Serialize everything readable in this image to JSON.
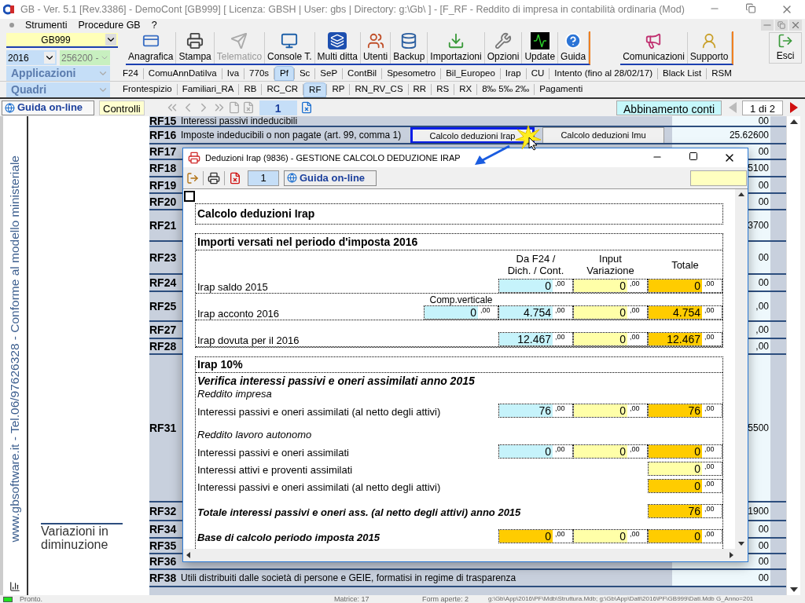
{
  "window": {
    "title": "GB - Ver. 5.1 [Rev.3386] -  DemoCont [GB999]      [ Licenza: GBSH | User: gbs | Directory: g:\\Gb\\ ] - [F_RF - Reddito di impresa in contabilità ordinaria (Mod)"
  },
  "menu": [
    "Strumenti",
    "Procedure GB",
    "?"
  ],
  "selectors": {
    "company": "GB999",
    "year": "2016",
    "code": "256200 -",
    "code_disabled": true,
    "app_menu": "Applicazioni",
    "form_menu": "Quadri"
  },
  "toolbar": {
    "main": [
      {
        "label": "Anagrafica",
        "disabled": false
      },
      {
        "label": "Stampa",
        "disabled": false
      },
      {
        "label": "Telematico",
        "disabled": true
      },
      {
        "label": "Console T.",
        "disabled": false
      },
      {
        "label": "Multi ditta",
        "disabled": false
      },
      {
        "label": "Utenti",
        "disabled": false
      },
      {
        "label": "Backup",
        "disabled": false
      },
      {
        "label": "Importazioni",
        "disabled": false
      },
      {
        "label": "Opzioni",
        "disabled": false
      },
      {
        "label": "Update",
        "disabled": false
      },
      {
        "label": "Guida",
        "disabled": false
      }
    ],
    "support": [
      {
        "label": "Comunicazioni",
        "disabled": false
      },
      {
        "label": "Supporto",
        "disabled": false
      }
    ],
    "exit": "Esci"
  },
  "app_tabs": [
    {
      "label": "F24",
      "selected": false
    },
    {
      "label": "ComuAnnDatiIva",
      "selected": false
    },
    {
      "label": "Iva",
      "selected": false
    },
    {
      "label": "770s",
      "selected": false
    },
    {
      "label": "Pf",
      "selected": true
    },
    {
      "label": "Sc",
      "selected": false
    },
    {
      "label": "SeP",
      "selected": false
    },
    {
      "label": "ContBil",
      "selected": false
    },
    {
      "label": "Spesometro",
      "selected": false
    },
    {
      "label": "Bil_Europeo",
      "selected": false
    },
    {
      "label": "Irap",
      "selected": false
    },
    {
      "label": "CU",
      "selected": false
    },
    {
      "label": "Intento (fino al 28/02/17)",
      "selected": false
    },
    {
      "label": "Black List",
      "selected": false
    },
    {
      "label": "RSM",
      "selected": false
    }
  ],
  "form_tabs": [
    {
      "label": "Frontespizio",
      "selected": false
    },
    {
      "label": "Familiari_RA",
      "selected": false
    },
    {
      "label": "RB",
      "selected": false
    },
    {
      "label": "RC_CR",
      "selected": false
    },
    {
      "label": "RF",
      "selected": true
    },
    {
      "label": "RP",
      "selected": false
    },
    {
      "label": "RN_RV_CS",
      "selected": false
    },
    {
      "label": "RR",
      "selected": false
    },
    {
      "label": "RS",
      "selected": false
    },
    {
      "label": "RX",
      "selected": false
    },
    {
      "label": "8‰ 5‰ 2‰",
      "selected": false
    },
    {
      "label": "Pagamenti",
      "selected": false
    }
  ],
  "nav": {
    "help": "Guida on-line",
    "checks": "Controlli",
    "page": "1",
    "link": "Abbinamento conti",
    "pages": "1 di 2"
  },
  "sidebar": {
    "vertical_text": "www.gbsoftware.it - Tel.06/97626328 - Conforme al modello ministeriale",
    "section": "Variazioni in diminuzione"
  },
  "rows": [
    {
      "code": "RF15",
      "description": "Interessi passivi indeducibili",
      "value": "00"
    },
    {
      "code": "RF16",
      "description": "Imposte indeducibili o non pagate (art. 99, comma 1)",
      "value": "25.62600"
    },
    {
      "code": "RF17",
      "value": "00"
    },
    {
      "code": "RF18",
      "value": "5100"
    },
    {
      "code": "RF19",
      "value": "00"
    },
    {
      "code": "RF20",
      "value": "00"
    },
    {
      "code": "RF21",
      "value": "3700"
    },
    {
      "code": "RF23",
      "value": "00"
    },
    {
      "code": "RF24",
      "value": "00"
    },
    {
      "code": "RF25",
      "value": ",00"
    },
    {
      "code": "RF27",
      "value": ",00"
    },
    {
      "code": "RF28",
      "value": ",00"
    },
    {
      "code": "RF31",
      "value": "5500"
    },
    {
      "code": "RF32",
      "value": "1900"
    },
    {
      "code": "RF34",
      "value": "00"
    },
    {
      "code": "RF35",
      "value": "00"
    },
    {
      "code": "RF36",
      "value": "00"
    },
    {
      "code": "RF38",
      "description": "Utili distribuiti dalle società di persone e GEIE, formatisi in regime di trasparenza",
      "value": "00"
    }
  ],
  "buttons": [
    {
      "label": "Calcolo deduzioni Irap",
      "highlighted": true
    },
    {
      "label": "Calcolo deduzioni Imu",
      "highlighted": false
    }
  ],
  "dialog": {
    "title": "Deduzioni Irap (9836) - GESTIONE CALCOLO DEDUZIONE IRAP",
    "page": "1",
    "help": "Guida on-line",
    "heading": "Calcolo deduzioni Irap",
    "section": {
      "title": "Importi versati nel periodo d'imposta 2016",
      "columns": [
        "Da F24 /\nDich. / Cont.",
        "Input\nVariazione",
        "Totale"
      ],
      "rows": [
        {
          "label": "Irap saldo 2015",
          "cells": {
            "f24": {
              "kind": "imported",
              "value": "0",
              "decimals": ",00"
            },
            "input": {
              "kind": "input",
              "value": "0",
              "decimals": ",00"
            },
            "total": {
              "kind": "computed",
              "value": "0",
              "decimals": ",00"
            }
          }
        },
        {
          "label": "Irap acconto 2016",
          "extra": {
            "label": "Comp.verticale",
            "cell": {
              "kind": "imported",
              "value": "0",
              "decimals": ",00"
            }
          },
          "cells": {
            "f24": {
              "kind": "imported",
              "value": "4.754",
              "decimals": ",00"
            },
            "input": {
              "kind": "input",
              "value": "0",
              "decimals": ",00"
            },
            "total": {
              "kind": "computed",
              "value": "4.754",
              "decimals": ",00"
            }
          }
        },
        {
          "label": "Irap dovuta per il 2016",
          "cells": {
            "f24": {
              "kind": "imported",
              "value": "12.467",
              "decimals": ",00"
            },
            "input": {
              "kind": "input",
              "value": "0",
              "decimals": ",00"
            },
            "total": {
              "kind": "computed",
              "value": "12.467",
              "decimals": ",00"
            }
          }
        }
      ]
    },
    "section2": {
      "title": "Irap 10%",
      "items": [
        {
          "kind": "subtitle",
          "text": "Verifica interessi passivi e oneri assimilati anno 2015"
        },
        {
          "kind": "group",
          "text": "Reddito impresa"
        },
        {
          "kind": "row",
          "text": "Interessi passivi e oneri assimilati (al netto degli attivi)",
          "cells": {
            "f24": {
              "kind": "imported",
              "value": "76",
              "decimals": ",00"
            },
            "input": {
              "kind": "input",
              "value": "0",
              "decimals": ",00"
            },
            "total": {
              "kind": "computed",
              "value": "76",
              "decimals": ",00"
            }
          }
        },
        {
          "kind": "group",
          "text": "Reddito lavoro autonomo"
        },
        {
          "kind": "row",
          "text": "Interessi passivi e oneri assimilati",
          "cells": {
            "f24": {
              "kind": "imported",
              "value": "0",
              "decimals": ",00"
            },
            "input": {
              "kind": "input",
              "value": "0",
              "decimals": ",00"
            },
            "total": {
              "kind": "computed",
              "value": "0",
              "decimals": ",00"
            }
          }
        },
        {
          "kind": "row",
          "text": "Interessi attivi e proventi assimilati",
          "cells": {
            "total": {
              "kind": "input",
              "value": "0",
              "decimals": ",00"
            }
          }
        },
        {
          "kind": "row",
          "text": "Interessi passivi e oneri assimilati (al netto degli attivi)",
          "cells": {
            "total": {
              "kind": "computed",
              "value": "0",
              "decimals": ",00"
            }
          }
        },
        {
          "kind": "total",
          "text": "Totale interessi passivi e oneri ass. (al netto degli attivi) anno 2015",
          "cells": {
            "total": {
              "kind": "computed",
              "value": "76",
              "decimals": ",00"
            }
          }
        },
        {
          "kind": "total",
          "text": "Base di calcolo periodo imposta 2015",
          "cells": {
            "f24": {
              "kind": "computed",
              "value": "0",
              "decimals": ",00"
            },
            "input": {
              "kind": "input",
              "value": "0",
              "decimals": ",00"
            },
            "total": {
              "kind": "computed",
              "value": "0",
              "decimals": ",00"
            }
          }
        }
      ]
    }
  },
  "status_bar": {
    "state": "Pronto.",
    "matrix": "Matrice: 17",
    "forms": "Form aperte: 2",
    "path": "g:\\Gb\\App\\2016\\PF\\Mdb\\Struttura.Mdb; g:\\Gb\\App\\Dati\\2016\\PF\\GB999\\Dati.Mdb G_Anno=201"
  }
}
